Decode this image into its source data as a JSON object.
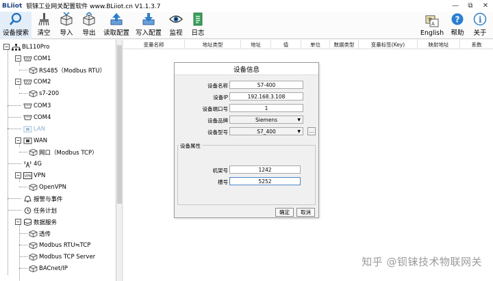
{
  "window": {
    "logo": "BLiiot",
    "title": "钡铼工业网关配置软件 www.BLiiot.cn V1.1.3.7",
    "controls": [
      "—",
      "⧉",
      "✕"
    ]
  },
  "toolbar": {
    "search": "设备搜索",
    "clear": "清空",
    "import": "导入",
    "export": "导出",
    "read_config": "读取配置",
    "write_config": "写入配置",
    "monitor": "监视",
    "log": "日志",
    "english": "English",
    "help": "帮助",
    "about": "关于"
  },
  "tree": {
    "root": "BL110Pro",
    "com1": "COM1",
    "com1_child": "RS485（Modbus RTU）",
    "com2": "COM2",
    "com2_child": "s7-200",
    "com3": "COM3",
    "com4": "COM4",
    "lan": "LAN",
    "wan": "WAN",
    "wan_child": "网口（Modbus TCP）",
    "g4": "4G",
    "vpn": "VPN",
    "vpn_child": "OpenVPN",
    "alarm": "报警与事件",
    "task": "任务计划",
    "data": "数据服务",
    "d1": "透传",
    "d2": "Modbus RTU≒TCP",
    "d3": "Modbus TCP Server",
    "d4": "BACnet/IP"
  },
  "grid": {
    "columns": [
      "变量名称",
      "地址类型",
      "地址",
      "值",
      "单位",
      "数据类型",
      "变量标签(Key)",
      "映射地址",
      "系数"
    ]
  },
  "dialog": {
    "title": "设备信息",
    "name_label": "设备名称",
    "name_value": "S7-400",
    "ip_label": "设备IP",
    "ip_value": "192.168.3.108",
    "port_label": "设备端口号",
    "port_value": "1",
    "brand_label": "设备品牌",
    "brand_value": "Siemens",
    "model_label": "设备型号",
    "model_value": "S7_400",
    "more_label": "...",
    "attr_label": "设备属性",
    "rack_label": "机架号",
    "rack_value": "1242",
    "slot_label": "槽号",
    "slot_value": "5252",
    "ok_label": "确定",
    "cancel_label": "取消"
  },
  "watermark": "知乎 @钡铼技术物联网关",
  "colors": {
    "accent_blue": "#1a6fc4",
    "lan_disabled": "#8cb4dc",
    "toolbar_selected": "#e4eef9"
  }
}
